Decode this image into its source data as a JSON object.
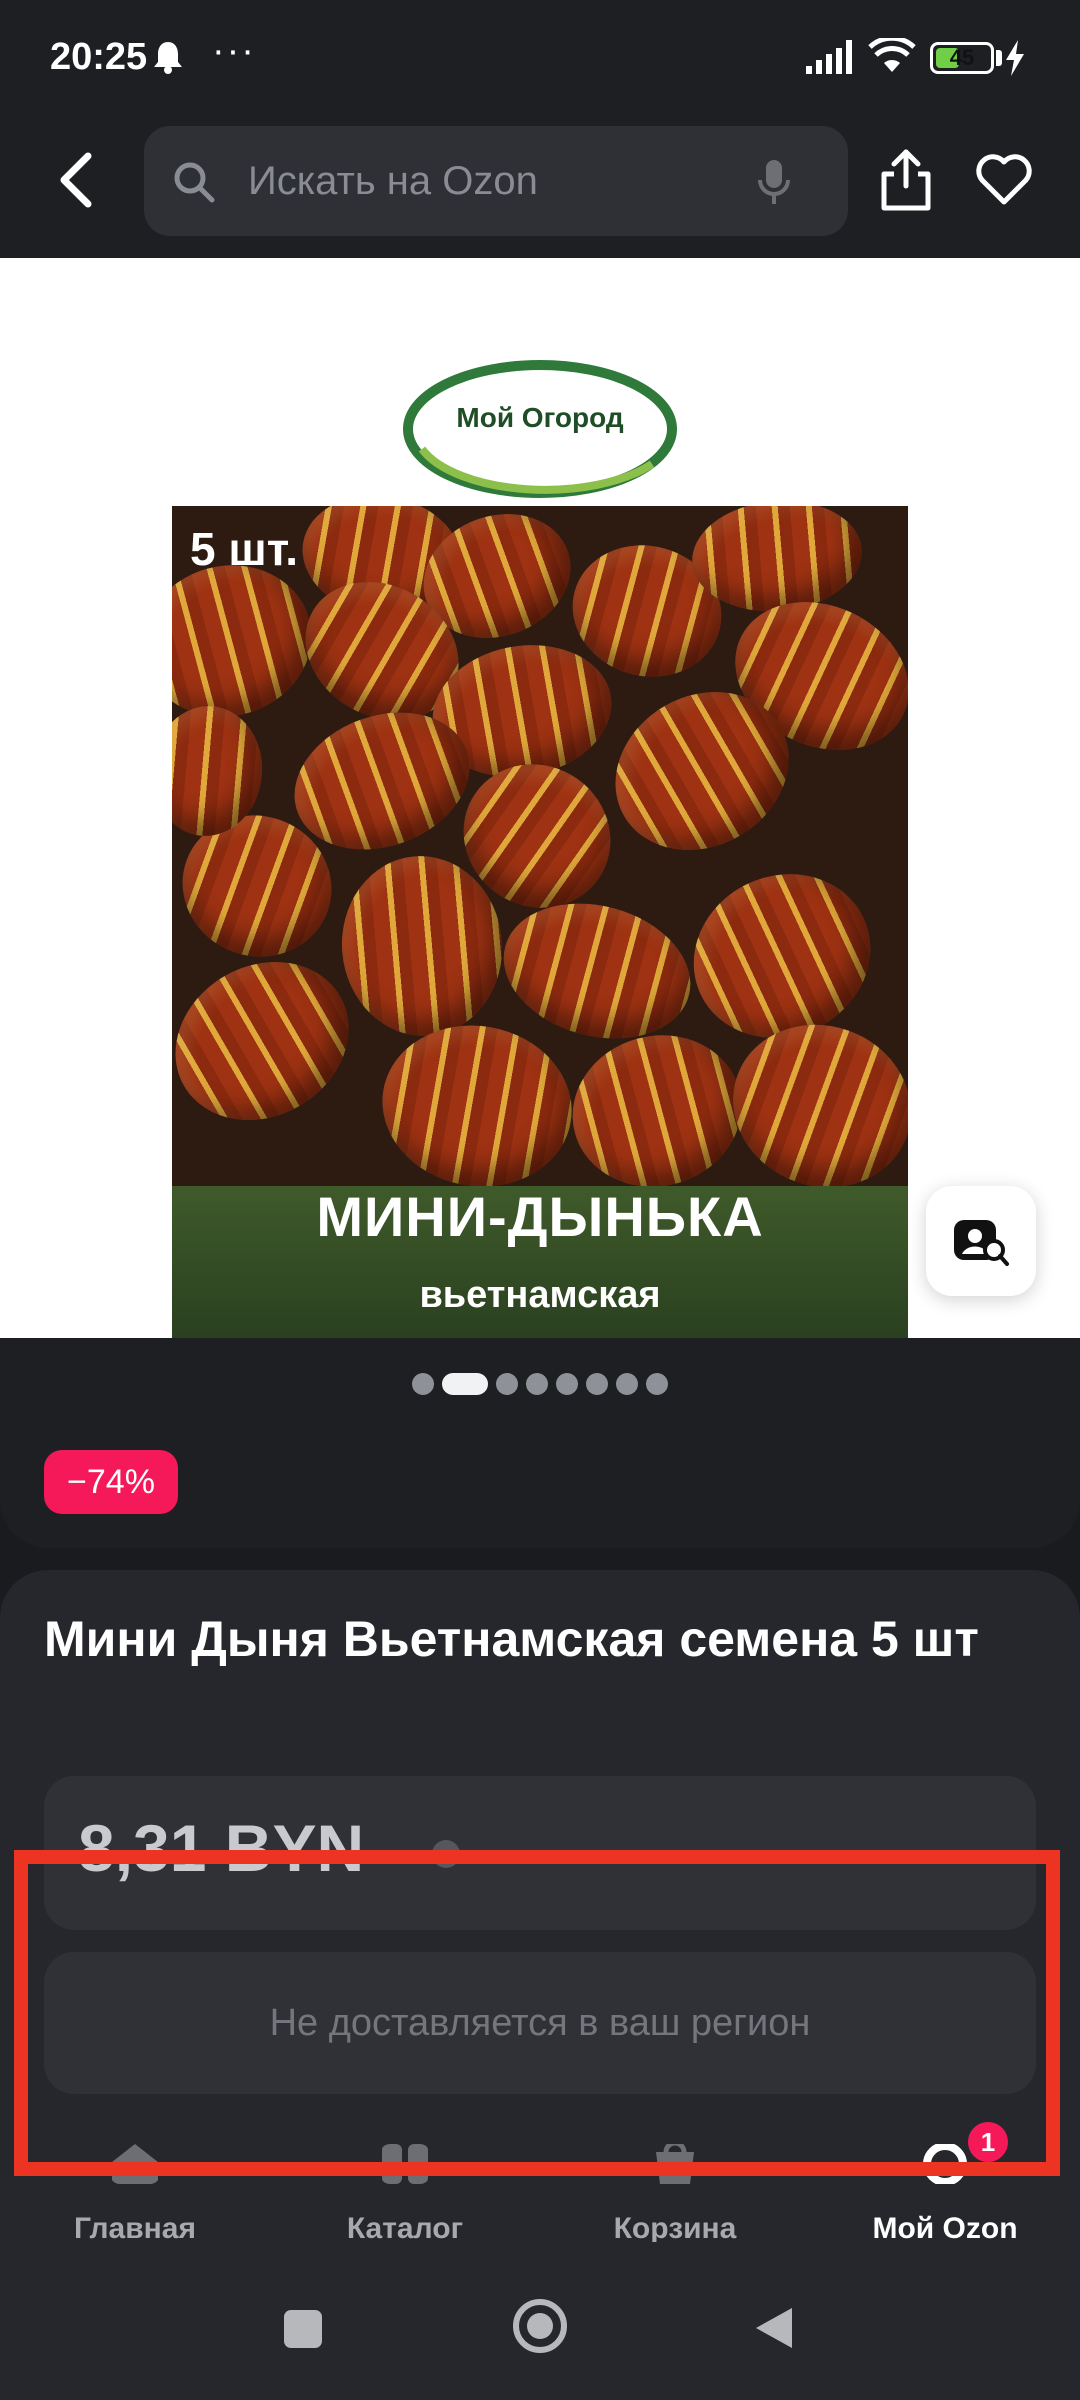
{
  "status_bar": {
    "time": "20:25",
    "more": "···",
    "battery_percent": "45",
    "battery_level": 0.45,
    "battery_color": "#6fd048"
  },
  "header": {
    "back_icon": "chevron-left-icon",
    "search_placeholder": "Искать на Ozon",
    "mic_icon": "mic-icon",
    "share_icon": "share-icon",
    "favorite_icon": "heart-icon"
  },
  "product_image": {
    "brand_logo_text": "Мой Огород",
    "quantity_badge": "5 шт.",
    "title_overlay": "МИНИ-ДЫНЬКА",
    "subtitle_overlay": "вьетнамская",
    "visual_search_icon": "visual-search-icon"
  },
  "gallery": {
    "total_images": 8,
    "active_index": 1
  },
  "discount": {
    "label": "−74%",
    "color": "#f5195a"
  },
  "product": {
    "title": "Мини Дыня Вьетнамская семена 5 шт",
    "price": "8,31 BYN",
    "delivery_notice": "Не доставляется в ваш регион"
  },
  "bottom_nav": {
    "items": [
      {
        "label": "Главная",
        "icon": "home-icon"
      },
      {
        "label": "Каталог",
        "icon": "catalog-icon"
      },
      {
        "label": "Корзина",
        "icon": "cart-icon"
      },
      {
        "label": "Мой Ozon",
        "icon": "profile-icon"
      }
    ],
    "active_index": 3,
    "badge_count": "1"
  },
  "highlight_color": "#ed3423"
}
